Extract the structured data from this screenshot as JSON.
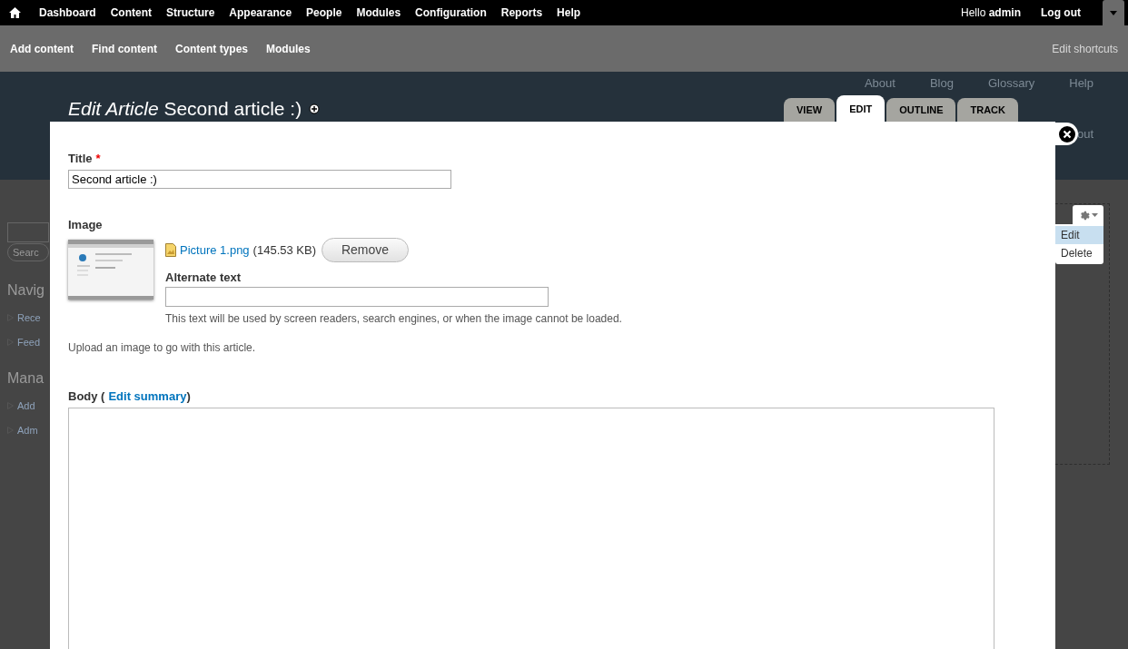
{
  "toolbar": {
    "menu": [
      "Dashboard",
      "Content",
      "Structure",
      "Appearance",
      "People",
      "Modules",
      "Configuration",
      "Reports",
      "Help"
    ],
    "greeting": "Hello **admin**",
    "logout": "Log out"
  },
  "shortcuts": {
    "items": [
      "Add content",
      "Find content",
      "Content types",
      "Modules"
    ],
    "edit": "Edit shortcuts"
  },
  "background": {
    "menu": [
      "About",
      "Blog",
      "Glossary",
      "Help"
    ],
    "cut_link": "out",
    "search_button": "Searc",
    "blocks": [
      {
        "title": "Navig",
        "links": [
          "Rece",
          "Feed"
        ]
      },
      {
        "title": "Mana",
        "links": [
          "Add",
          "Adm"
        ]
      }
    ]
  },
  "overlay": {
    "title_kind": "Edit Article",
    "title": "Second article :)",
    "tabs": [
      {
        "label": "VIEW",
        "selected": false
      },
      {
        "label": "EDIT",
        "selected": true
      },
      {
        "label": "OUTLINE",
        "selected": false
      },
      {
        "label": "TRACK",
        "selected": false
      }
    ],
    "form": {
      "title_label": "Title",
      "required_mark": "*",
      "title_value": "Second article :)",
      "image_label": "Image",
      "file_name": "Picture 1.png",
      "file_size": "(145.53 KB)",
      "remove_button": "Remove",
      "alt_label": "Alternate text",
      "alt_help": "This text will be used by screen readers, search engines, or when the image cannot be loaded.",
      "image_help": "Upload an image to go with this article.",
      "body_label": "Body (",
      "body_link": "Edit summary",
      "body_close": ")"
    }
  },
  "block_menu": {
    "items": [
      {
        "label": "Edit",
        "selected": true
      },
      {
        "label": "Delete",
        "selected": false
      }
    ]
  }
}
